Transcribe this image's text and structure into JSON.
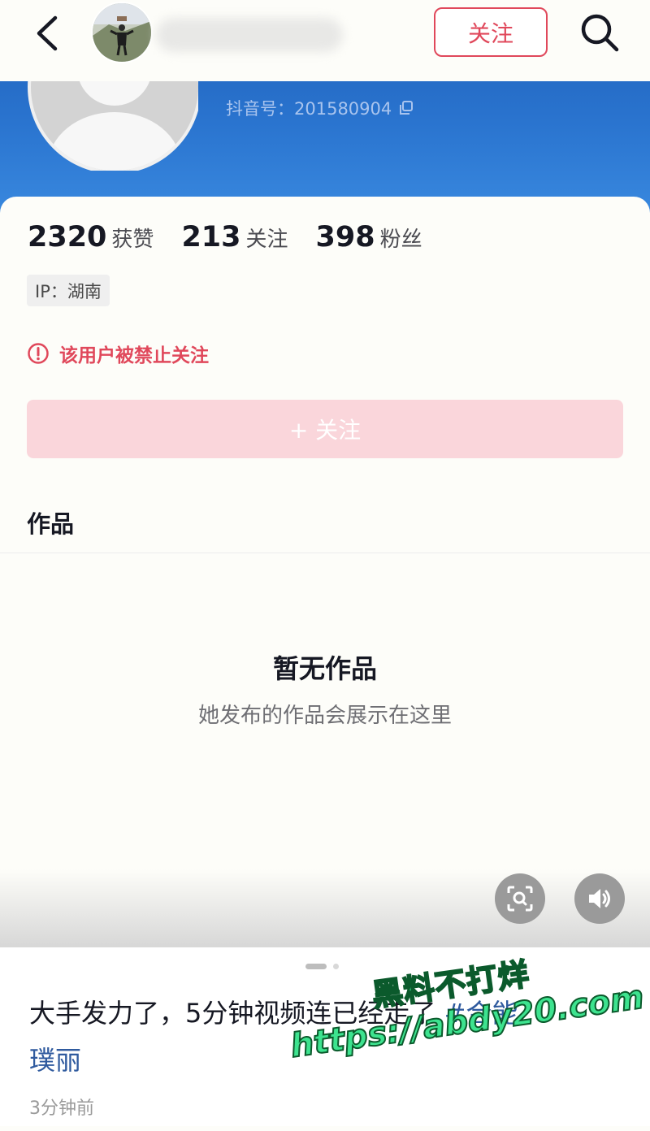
{
  "header": {
    "follow_label": "关注"
  },
  "profile": {
    "douyin_id": "抖音号：201580904"
  },
  "stats": [
    {
      "num": "2320",
      "label": "获赞"
    },
    {
      "num": "213",
      "label": "关注"
    },
    {
      "num": "398",
      "label": "粉丝"
    }
  ],
  "ip_tag": "IP：湖南",
  "ban_notice": "该用户被禁止关注",
  "follow_button": "+ 关注",
  "works": {
    "title": "作品",
    "empty_title": "暂无作品",
    "empty_subtitle": "她发布的作品会展示在这里"
  },
  "post": {
    "caption_text": "大手发力了，5分钟视频连",
    "caption_middle": "已经走了",
    "hashtag_part1": "#合能",
    "hashtag_part2": "璞丽",
    "time_ago": "3分钟前"
  },
  "watermark": {
    "line1": "黑料不打烊",
    "line2": "https://abdy20.com"
  },
  "colors": {
    "accent": "#e0485b",
    "banner_blue": "#2a74cf",
    "follow_disabled": "#fad6db",
    "hashtag": "#2f5a9e",
    "watermark_green": "#3de38f"
  }
}
